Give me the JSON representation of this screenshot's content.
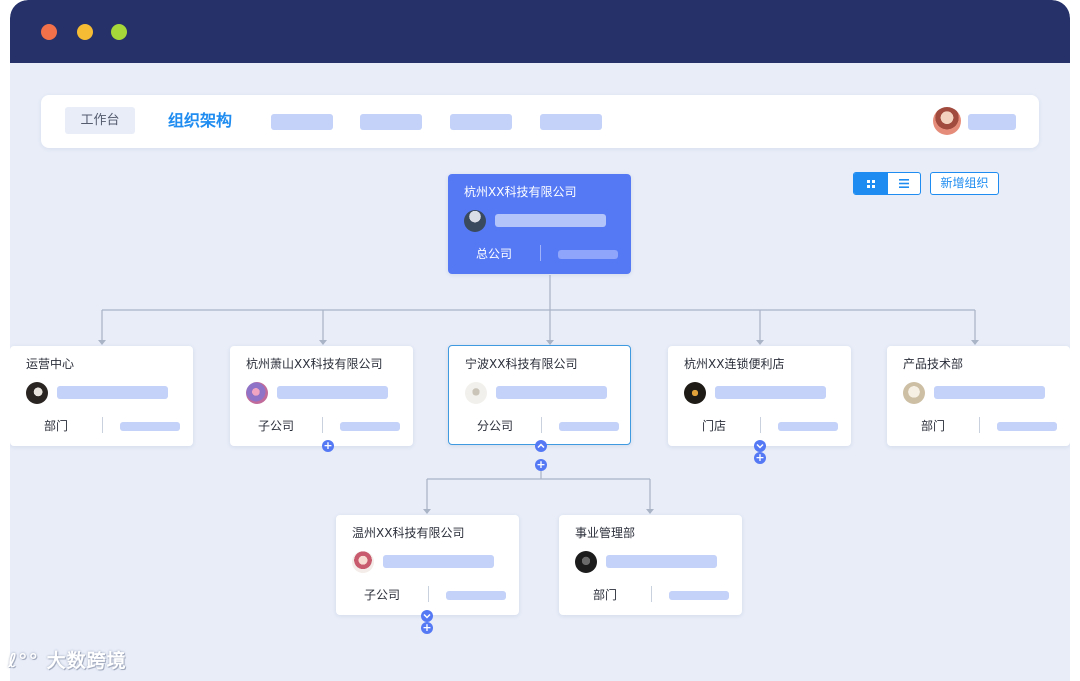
{
  "navbar": {
    "workbench_tab": "工作台",
    "title": "组织架构"
  },
  "toolbar": {
    "grid_view_icon": "grid-icon",
    "list_view_icon": "list-icon",
    "add_org_label": "新增组织"
  },
  "org": {
    "root": {
      "name": "杭州XX科技有限公司",
      "type": "总公司"
    },
    "children": [
      {
        "name": "运营中心",
        "type": "部门"
      },
      {
        "name": "杭州萧山XX科技有限公司",
        "type": "子公司"
      },
      {
        "name": "宁波XX科技有限公司",
        "type": "分公司"
      },
      {
        "name": "杭州XX连锁便利店",
        "type": "门店"
      },
      {
        "name": "产品技术部",
        "type": "部门"
      }
    ],
    "grandchildren": [
      {
        "name": "温州XX科技有限公司",
        "type": "子公司"
      },
      {
        "name": "事业管理部",
        "type": "部门"
      }
    ]
  },
  "colors": {
    "titlebar": "#253168",
    "accent": "#1e8cf0",
    "root_card": "#5579f5",
    "placeholder": "#c4d1f8"
  },
  "watermark": "大数跨境"
}
